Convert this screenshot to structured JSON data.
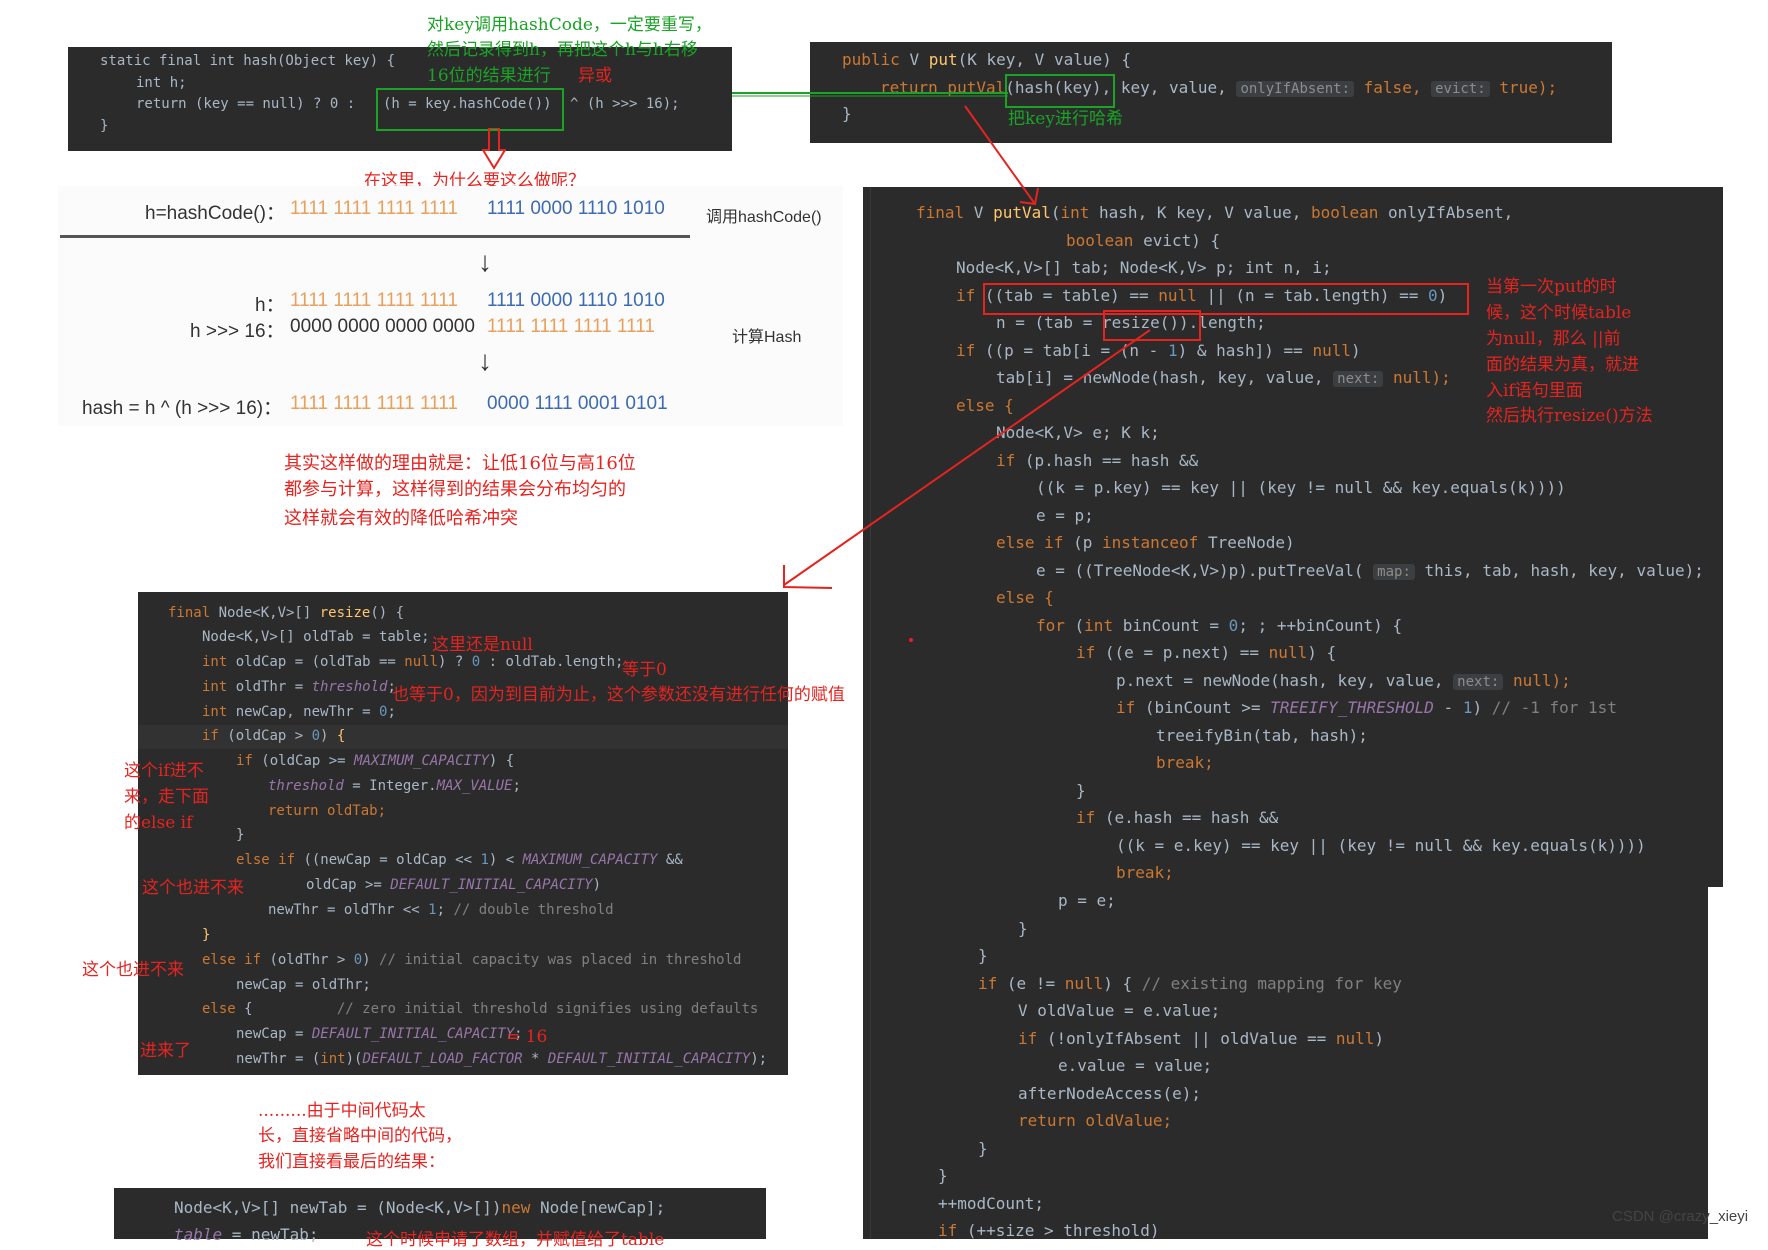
{
  "hash_snippet": {
    "l1": "static final int hash(Object key) {",
    "l2": "int h;",
    "l3a": "return (key == null) ? 0 :",
    "l3b": "(h = key.hashCode())",
    "l3c": "^ (h >>> 16);",
    "l4": "}"
  },
  "put_snippet": {
    "l1": "public V put(K key, V value) {",
    "l2a": "return putVal",
    "l2b": "(hash(key)",
    "l2c": ", key, value,",
    "hint1": "onlyIfAbsent:",
    "l2d": "false,",
    "hint2": "evict:",
    "l2e": "true);",
    "l3": "}"
  },
  "annotations": {
    "hashcode_note_1": "对key调用hashCode，一定要重写，",
    "hashcode_note_2": "然后记录得到h，再把这个h与h右移",
    "hashcode_note_3a": "16位的结果进行",
    "hashcode_note_3b": "异或",
    "why_question": "在这里，为什么要这么做呢？",
    "hash_key_note": "把key进行哈希",
    "reason_1": "其实这样做的理由就是：让低16位与高16位",
    "reason_2": "都参与计算，这样得到的结果会分布均匀的",
    "reason_3": "这样就会有效的降低哈希冲突",
    "first_put_note": [
      "当第一次put的时",
      "候，这个时候table",
      "为null，那么 ||前",
      "面的结果为真，就进",
      "入if语句里面",
      "然后执行resize()方法"
    ],
    "still_null": "这里还是null",
    "equals_zero": "等于0",
    "thr_zero": "也等于0，因为到目前为止，这个参数还没有进行任何的赋值",
    "if_not_enter": [
      "这个if进不",
      "来，走下面",
      "的else if"
    ],
    "also_not_1": "这个也进不来",
    "also_not_2": "这个也进不来",
    "entered": "进来了",
    "eq16": "= 16",
    "omit_1": ".........由于中间代码太",
    "omit_2": "长，直接省略中间的代码，",
    "omit_3": "我们直接看最后的结果：",
    "new_table_note": "这个时候申请了数组，并赋值给了table"
  },
  "diagram": {
    "row1_label": "h=hashCode()：",
    "row1_hi": "1111 1111 1111 1111",
    "row1_lo": "1111 0000 1110 1010",
    "right1": "调用hashCode()",
    "row2_label": "h：",
    "row2_hi": "1111 1111 1111 1111",
    "row2_lo": "1111 0000 1110 1010",
    "row3_label": "h >>> 16：",
    "row3_hi": "0000 0000 0000 0000",
    "row3_lo": "1111 1111 1111 1111",
    "right2": "计算Hash",
    "row4_label": "hash = h ^ (h >>> 16)：",
    "row4_hi": "1111 1111 1111 1111",
    "row4_lo": "0000 1111 0001 0101"
  },
  "putval": {
    "l1a": "final V putVal(int hash, K key, V value, boolean onlyIfAbsent,",
    "l2": "boolean evict) {",
    "l3": "Node<K,V>[] tab; Node<K,V> p; int n, i;",
    "l4": "if ((tab = table) == null || (n = tab.length) == 0)",
    "l5a": "n = (tab =",
    "l5b": "resize())",
    "l5c": ".length;",
    "l6": "if ((p = tab[i = (n - 1) & hash]) == null)",
    "l7a": "tab[i] = newNode(hash, key, value,",
    "hint_next": "next:",
    "l7b": "null);",
    "l8": "else {",
    "l9": "Node<K,V> e; K k;",
    "l10": "if (p.hash == hash &&",
    "l11": "((k = p.key) == key || (key != null && key.equals(k))))",
    "l12": "e = p;",
    "l13": "else if (p instanceof TreeNode)",
    "l14a": "e = ((TreeNode<K,V>)p).putTreeVal(",
    "hint_map": "map:",
    "l14b": "this, tab, hash, key, value);",
    "l15": "else {",
    "l16": "for (int binCount = 0; ; ++binCount) {",
    "l17": "if ((e = p.next) == null) {",
    "l18a": "p.next = newNode(hash, key, value,",
    "l18b": "null);",
    "l19a": "if (binCount >= TREEIFY_THRESHOLD - 1)",
    "l19b": "// -1 for 1st",
    "l20": "treeifyBin(tab, hash);",
    "l21": "break;",
    "l22": "}",
    "l23": "if (e.hash == hash &&",
    "l24": "((k = e.key) == key || (key != null && key.equals(k))))",
    "l25": "break;",
    "l26": "p = e;",
    "l27": "}",
    "l28": "}",
    "l29a": "if (e != null) {",
    "l29b": "// existing mapping for key",
    "l30": "V oldValue = e.value;",
    "l31": "if (!onlyIfAbsent || oldValue == null)",
    "l32": "e.value = value;",
    "l33": "afterNodeAccess(e);",
    "l34": "return oldValue;",
    "l35": "}",
    "l36": "}",
    "l37": "++modCount;",
    "l38": "if (++size > threshold)"
  },
  "resize": {
    "l1": "final Node<K,V>[] resize() {",
    "l2": "Node<K,V>[] oldTab = table;",
    "l3a": "int oldCap = (oldTab == null) ? 0 : oldTab.length;",
    "l4a": "int oldThr = threshold;",
    "l5": "int newCap, newThr = 0;",
    "l6": "if (oldCap > 0) {",
    "l7": "if (oldCap >= MAXIMUM_CAPACITY) {",
    "l8": "threshold = Integer.MAX_VALUE;",
    "l9": "return oldTab;",
    "l10": "}",
    "l11": "else if ((newCap = oldCap << 1) < MAXIMUM_CAPACITY &&",
    "l12": "oldCap >= DEFAULT_INITIAL_CAPACITY)",
    "l13": "newThr = oldThr << 1; // double threshold",
    "l14": "}",
    "l15a": "else if (oldThr > 0)",
    "l15b": "// initial capacity was placed in threshold",
    "l16": "newCap = oldThr;",
    "l17a": "else {",
    "l17b": "// zero initial threshold signifies using defaults",
    "l18": "newCap = DEFAULT_INITIAL_CAPACITY;",
    "l19": "newThr = (int)(DEFAULT_LOAD_FACTOR * DEFAULT_INITIAL_CAPACITY);"
  },
  "newtab": {
    "l1": "Node<K,V>[] newTab = (Node<K,V>[])new Node[newCap];",
    "l2": "table = newTab;"
  },
  "watermark": "CSDN @crazy_xieyi"
}
